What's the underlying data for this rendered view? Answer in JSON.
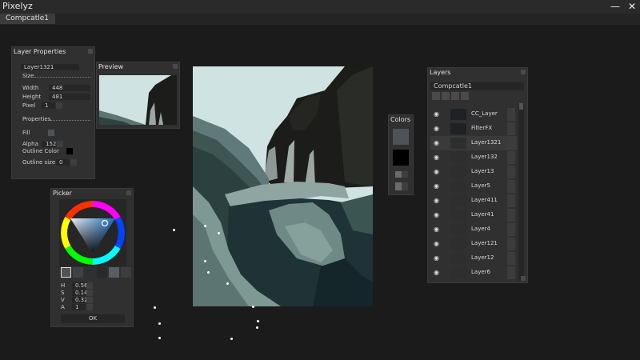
{
  "app": {
    "title": "Pixelyz",
    "minimize_icon": "—",
    "close_icon": "✕"
  },
  "tabs": [
    {
      "label": "Compcatle1"
    }
  ],
  "layer_properties": {
    "title": "Layer Properties",
    "name": "Layer1321",
    "size_label": "Size",
    "width_label": "Width",
    "width_value": "448",
    "height_label": "Height",
    "height_value": "481",
    "pixel_label": "Pixel",
    "pixel_value": "1",
    "properties_label": "Properties",
    "fill_label": "Fill",
    "alpha_label": "Alpha",
    "alpha_value": "152",
    "outline_color_label": "Outline Color",
    "outline_size_label": "Outline size",
    "outline_size_value": "0"
  },
  "preview": {
    "title": "Preview"
  },
  "picker": {
    "title": "Picker",
    "h_label": "H",
    "h_value": "0.56",
    "s_label": "S",
    "s_value": "0.14",
    "v_label": "V",
    "v_value": "0.32",
    "a_label": "A",
    "a_value": "1",
    "ok_label": "OK"
  },
  "colors_panel": {
    "title": "Colors",
    "primary": "#4f5358",
    "secondary": "#000000"
  },
  "layers_panel": {
    "title": "Layers",
    "composition": "Compcatle1",
    "layers": [
      {
        "name": "CC_Layer"
      },
      {
        "name": "FilterFX"
      },
      {
        "name": "Layer1321"
      },
      {
        "name": "Layer132"
      },
      {
        "name": "Layer13"
      },
      {
        "name": "Layer5"
      },
      {
        "name": "Layer411"
      },
      {
        "name": "Layer41"
      },
      {
        "name": "Layer4"
      },
      {
        "name": "Layer121"
      },
      {
        "name": "Layer12"
      },
      {
        "name": "Layer6"
      }
    ]
  },
  "palette": {
    "sky": "#cfe3e2",
    "cliff": "#1c1d1a",
    "water": "#1f3236",
    "mid": "#6f8987",
    "light": "#9eb2ad"
  }
}
